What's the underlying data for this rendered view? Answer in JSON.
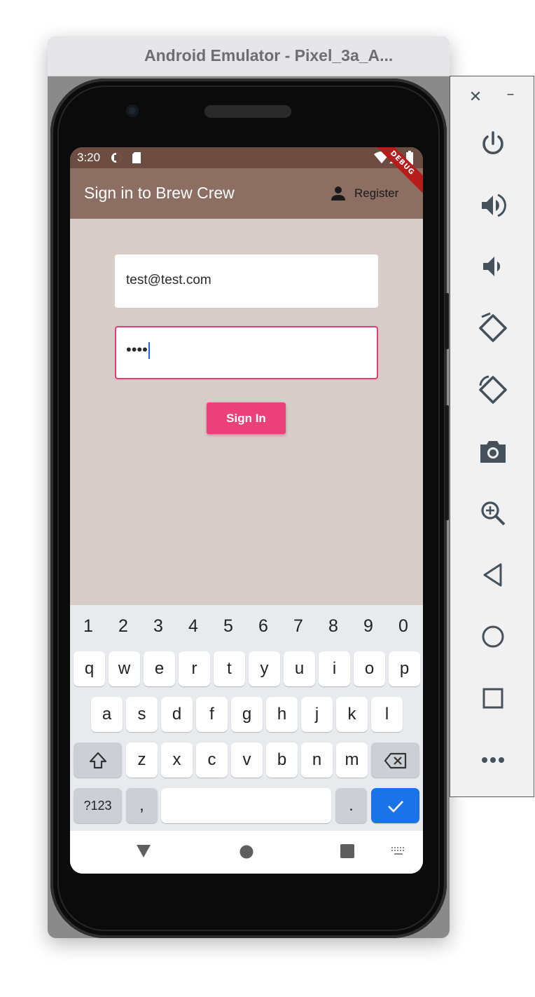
{
  "window": {
    "title": "Android Emulator - Pixel_3a_A..."
  },
  "status_bar": {
    "time": "3:20",
    "debug_banner": "DEBUG"
  },
  "app_bar": {
    "title": "Sign in to Brew Crew",
    "register_label": "Register"
  },
  "form": {
    "email_value": "test@test.com",
    "password_masked": "••••",
    "sign_in_label": "Sign In"
  },
  "keyboard": {
    "number_row": [
      "1",
      "2",
      "3",
      "4",
      "5",
      "6",
      "7",
      "8",
      "9",
      "0"
    ],
    "row1": [
      "q",
      "w",
      "e",
      "r",
      "t",
      "y",
      "u",
      "i",
      "o",
      "p"
    ],
    "row2": [
      "a",
      "s",
      "d",
      "f",
      "g",
      "h",
      "j",
      "k",
      "l"
    ],
    "row3": [
      "z",
      "x",
      "c",
      "v",
      "b",
      "n",
      "m"
    ],
    "symbols_label": "?123",
    "comma_label": ",",
    "period_label": "."
  },
  "colors": {
    "app_bar": "#8d6e63",
    "status_bar": "#6d4c41",
    "screen_background": "#d7ccc8",
    "accent": "#ec407a",
    "keyboard_action": "#1a73e8"
  },
  "toolbar": {
    "icons": [
      "close-icon",
      "minimize-icon",
      "power-icon",
      "volume-up-icon",
      "volume-down-icon",
      "rotate-left-icon",
      "rotate-right-icon",
      "camera-icon",
      "zoom-icon",
      "back-icon",
      "home-icon",
      "overview-icon",
      "more-icon"
    ]
  }
}
